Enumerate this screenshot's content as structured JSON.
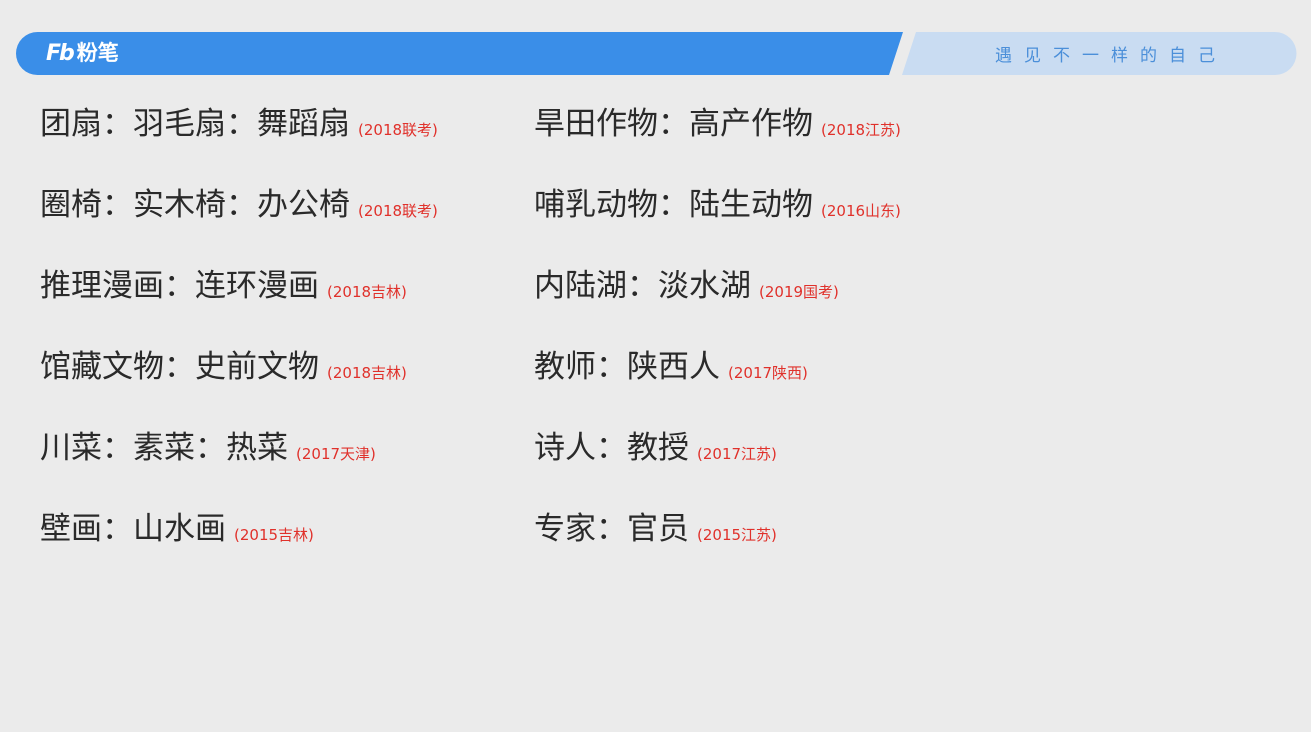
{
  "header": {
    "logo_mark": "Fb",
    "logo_text": "粉笔",
    "slogan": "遇见不一样的自己",
    "colors": {
      "banner_blue": "#3a8ee8",
      "banner_light": "#c9dcf2",
      "slogan_text": "#4b8fd9"
    }
  },
  "items": [
    {
      "text": "团扇：羽毛扇：舞蹈扇",
      "source": "(2018联考)"
    },
    {
      "text": "旱田作物：高产作物",
      "source": "(2018江苏)"
    },
    {
      "text": "圈椅：实木椅：办公椅",
      "source": "(2018联考)"
    },
    {
      "text": "哺乳动物：陆生动物",
      "source": "(2016山东)"
    },
    {
      "text": "推理漫画：连环漫画",
      "source": "(2018吉林)"
    },
    {
      "text": "内陆湖：淡水湖",
      "source": "(2019国考)"
    },
    {
      "text": "馆藏文物：史前文物",
      "source": "(2018吉林)"
    },
    {
      "text": "教师：陕西人",
      "source": "(2017陕西)"
    },
    {
      "text": "川菜：素菜：热菜",
      "source": "(2017天津)"
    },
    {
      "text": "诗人：教授",
      "source": "(2017江苏)"
    },
    {
      "text": "壁画：山水画",
      "source": "(2015吉林)"
    },
    {
      "text": "专家：官员",
      "source": "(2015江苏)"
    }
  ],
  "colors": {
    "background": "#ebebeb",
    "item_text": "#2a2a2a",
    "source_text": "#e0312b"
  }
}
